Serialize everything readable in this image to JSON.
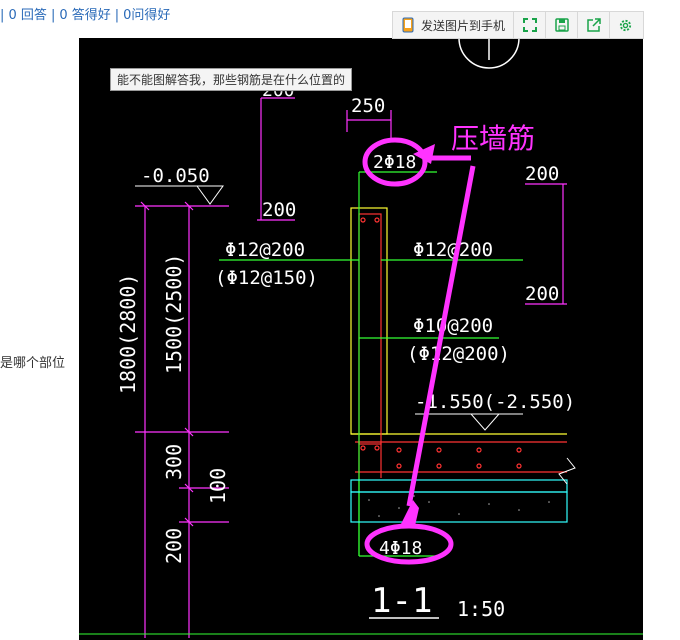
{
  "stats": {
    "answers": "0 回答",
    "good_answers": "0 答得好",
    "good_questions": "0问得好",
    "separator": "|"
  },
  "side_text": "是哪个部位",
  "toolbar": {
    "send_label": "发送图片到手机",
    "icons": [
      "phone-icon",
      "fullscreen-icon",
      "save-icon",
      "share-icon",
      "settings-icon"
    ]
  },
  "tooltip": "能不能图解答我，那些钢筋是在什么位置的",
  "drawing": {
    "annotation": "压墙筋",
    "dim_250": "250",
    "top_bar": "2Φ18",
    "bottom_bar": "4Φ18",
    "elev_top": "-0.050",
    "elev_bottom": "-1.550(-2.550)",
    "dim_1800": "1800(2800)",
    "dim_1500": "1500(2500)",
    "dim_300": "300",
    "dim_100": "100",
    "dim_200_left": "200",
    "dim_200_a": "200",
    "dim_200_b": "200",
    "dim_200_c": "200",
    "dim_200_d": "200",
    "rebar_left_1": "Φ12@200",
    "rebar_left_2": "(Φ12@150)",
    "rebar_right_1": "Φ12@200",
    "rebar_mid_1": "Φ10@200",
    "rebar_mid_2": "(Φ12@200)",
    "section_label": "1-1",
    "scale": "1:50"
  },
  "colors": {
    "magenta": "#ff33ff",
    "cad_green": "#33ff33",
    "cad_red": "#ff3333",
    "cad_yellow": "#ffff33",
    "cad_cyan": "#33ffff",
    "link_blue": "#2a6ab8"
  }
}
